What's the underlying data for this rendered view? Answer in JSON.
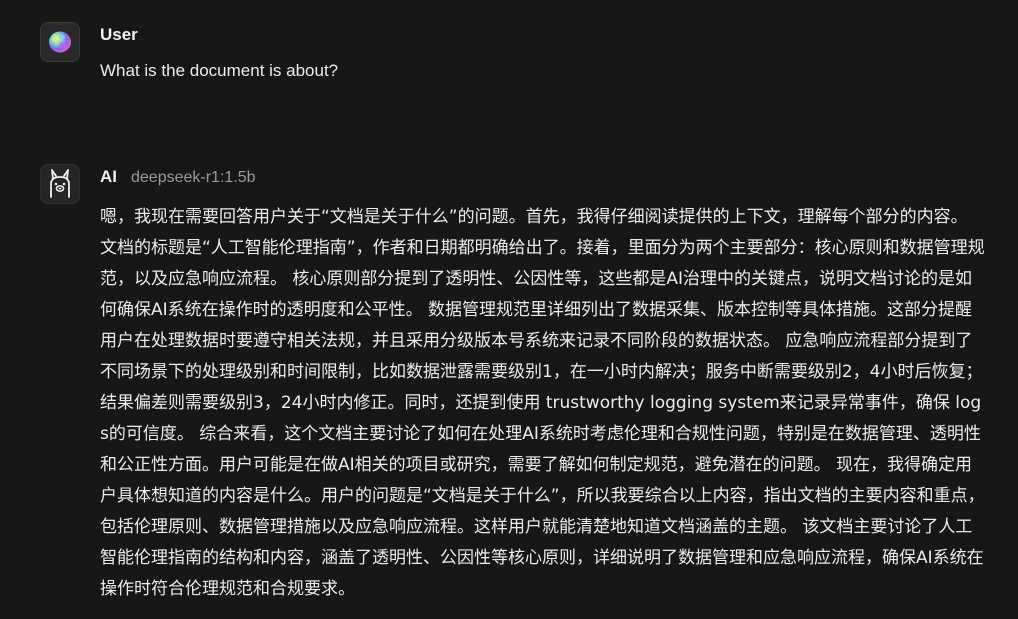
{
  "messages": {
    "user": {
      "name": "User",
      "text": "What is the document is about?"
    },
    "ai": {
      "name": "AI",
      "model": "deepseek-r1:1.5b",
      "text": "嗯，我现在需要回答用户关于“文档是关于什么”的问题。首先，我得仔细阅读提供的上下文，理解每个部分的内容。 文档的标题是“人工智能伦理指南”，作者和日期都明确给出了。接着，里面分为两个主要部分：核心原则和数据管理规范，以及应急响应流程。 核心原则部分提到了透明性、公因性等，这些都是AI治理中的关键点，说明文档讨论的是如何确保AI系统在操作时的透明度和公平性。 数据管理规范里详细列出了数据采集、版本控制等具体措施。这部分提醒用户在处理数据时要遵守相关法规，并且采用分级版本号系统来记录不同阶段的数据状态。 应急响应流程部分提到了不同场景下的处理级别和时间限制，比如数据泄露需要级别1，在一小时内解决；服务中断需要级别2，4小时后恢复；结果偏差则需要级别3，24小时内修正。同时，还提到使用 trustworthy logging system来记录异常事件，确保 logs的可信度。 综合来看，这个文档主要讨论了如何在处理AI系统时考虑伦理和合规性问题，特别是在数据管理、透明性和公正性方面。用户可能是在做AI相关的项目或研究，需要了解如何制定规范，避免潜在的问题。 现在，我得确定用户具体想知道的内容是什么。用户的问题是“文档是关于什么”，所以我要综合以上内容，指出文档的主要内容和重点，包括伦理原则、数据管理措施以及应急响应流程。这样用户就能清楚地知道文档涵盖的主题。 该文档主要讨论了人工智能伦理指南的结构和内容，涵盖了透明性、公因性等核心原则，详细说明了数据管理和应急响应流程，确保AI系统在操作时符合伦理规范和合规要求。"
    }
  },
  "icons": {
    "user_avatar": "colorful-blob-avatar-icon",
    "ai_avatar": "llama-avatar-icon"
  },
  "colors": {
    "background": "#171717",
    "text": "#ececec",
    "muted": "#9a9a9a"
  }
}
